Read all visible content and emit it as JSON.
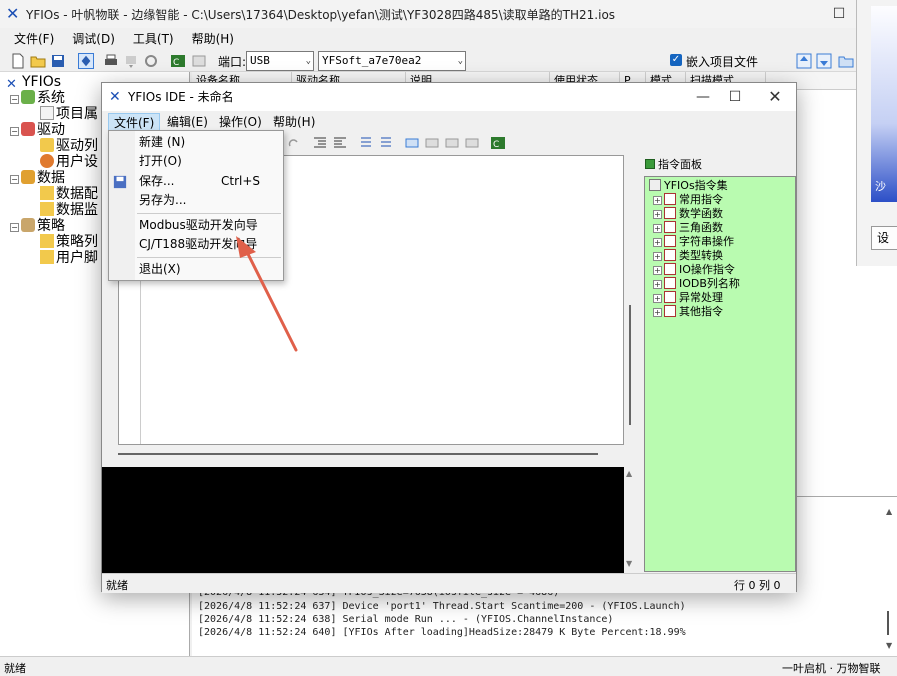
{
  "main": {
    "title": "YFIOs - 叶帆物联 - 边缘智能 - C:\\Users\\17364\\Desktop\\yefan\\测试\\YF3028四路485\\读取单路的TH21.ios",
    "menu": [
      "文件(F)",
      "调试(D)",
      "工具(T)",
      "帮助(H)"
    ],
    "toolbar": {
      "port_label": "端口:",
      "port_value": "USB",
      "device_value": "YFSoft_a7e70ea2",
      "embed_label": "嵌入项目文件"
    },
    "tree": [
      {
        "label": "YFIOs",
        "level": 0
      },
      {
        "label": "系统",
        "level": 1
      },
      {
        "label": "项目属",
        "level": 2
      },
      {
        "label": "驱动",
        "level": 1
      },
      {
        "label": "驱动列",
        "level": 2
      },
      {
        "label": "用户设",
        "level": 2
      },
      {
        "label": "数据",
        "level": 1
      },
      {
        "label": "数据配",
        "level": 2
      },
      {
        "label": "数据监",
        "level": 2
      },
      {
        "label": "策略",
        "level": 1
      },
      {
        "label": "策略列",
        "level": 2
      },
      {
        "label": "用户脚",
        "level": 2
      }
    ],
    "grid_headers": [
      "设备名称",
      "驱动名称",
      "说明",
      "使用状态",
      "P",
      "模式",
      "扫描模式"
    ],
    "log_lines": [
      "[2026/4/8 11:52:24 634] YFIOs_Size=7638(iosfile_size = 4686)",
      "[2026/4/8 11:52:24 637] Device 'port1' Thread.Start Scantime=200 - (YFIOS.Launch)",
      "[2026/4/8 11:52:24 638] Serial mode Run ... - (YFIOS.ChannelInstance)",
      "[2026/4/8 11:52:24 640] [YFIOs After loading]HeadSize:28479 K Byte Percent:18.99%"
    ],
    "status_left": "就绪",
    "status_right": "一叶启机 · 万物智联"
  },
  "side_dialog": {
    "button_label": "设",
    "gradient_text": "沙"
  },
  "ide": {
    "title": "YFIOs IDE - 未命名",
    "menu": [
      "文件(F)",
      "编辑(E)",
      "操作(O)",
      "帮助(H)"
    ],
    "status_left": "就绪",
    "status_right": "行 0 列 0"
  },
  "file_menu": {
    "items": [
      {
        "label": "新建",
        "shortcut_hint": "(N)"
      },
      {
        "label": "打开(O)",
        "shortcut": ""
      },
      {
        "label": "保存...",
        "shortcut": "Ctrl+S"
      },
      {
        "label": "另存为...",
        "shortcut": ""
      },
      {
        "label": "Modbus驱动开发向导",
        "shortcut": ""
      },
      {
        "label": "CJ/T188驱动开发向导",
        "shortcut": ""
      },
      {
        "label": "退出(X)",
        "shortcut": ""
      }
    ]
  },
  "command_panel": {
    "title": "指令面板",
    "root": "YFIOs指令集",
    "items": [
      "常用指令",
      "数学函数",
      "三角函数",
      "字符串操作",
      "类型转换",
      "IO操作指令",
      "IODB列名称",
      "异常处理",
      "其他指令"
    ]
  },
  "colors": {
    "cmd_tree_bg": "#b9fbb0",
    "console_bg": "#000000",
    "menu_highlight": "#cce4f7",
    "annotation_arrow": "#e0604a"
  }
}
